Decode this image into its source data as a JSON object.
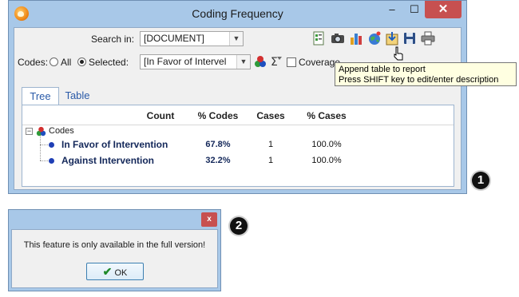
{
  "window": {
    "title": "Coding Frequency",
    "minimize": "–",
    "maximize": "☐",
    "close": "✕"
  },
  "search": {
    "label": "Search in:",
    "value": "[DOCUMENT]"
  },
  "codes": {
    "label": "Codes:",
    "option_all": "All",
    "option_selected": "Selected:",
    "selected_radio": "Selected",
    "selected_value": "[In Favor of Intervel",
    "coverage_label": "Coverage"
  },
  "toolbar": {
    "icons": [
      "checklist-icon",
      "camera-icon",
      "bar-chart-icon",
      "globe-icon",
      "append-report-icon",
      "save-icon",
      "print-icon"
    ]
  },
  "tooltip": {
    "line1": "Append table to report",
    "line2": "Press SHIFT key to edit/enter description"
  },
  "tabs": [
    "Tree",
    "Table"
  ],
  "table": {
    "headers": [
      "Count",
      "% Codes",
      "Cases",
      "% Cases"
    ],
    "root": "Codes",
    "rows": [
      {
        "label": "In Favor of Intervention",
        "count": "67.8%",
        "cases": "1",
        "pct_cases": "100.0%",
        "dot_color": "#1f3fb5"
      },
      {
        "label": "Against Intervention",
        "count": "32.2%",
        "cases": "1",
        "pct_cases": "100.0%",
        "dot_color": "#1f3fb5"
      }
    ]
  },
  "markers": [
    "1",
    "2"
  ],
  "dialog": {
    "close": "x",
    "message": "This feature is only available in the full version!",
    "ok_label": "OK"
  },
  "colors": {
    "frame": "#a8c8e8",
    "close_red": "#c75050",
    "tab_blue": "#2a5aa8"
  }
}
